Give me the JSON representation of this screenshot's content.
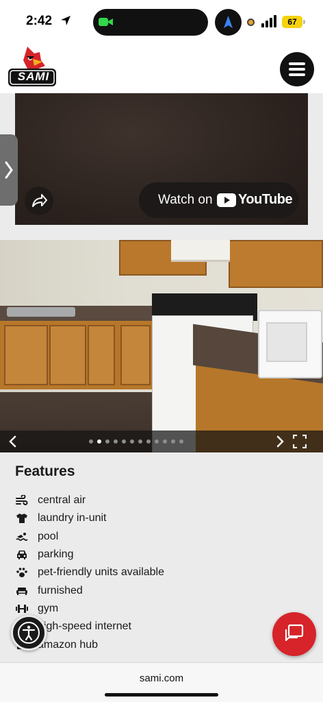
{
  "status_bar": {
    "time": "2:42",
    "battery": "67"
  },
  "header": {
    "logo_text": "SAMI",
    "menu_icon": "hamburger-icon"
  },
  "video": {
    "watch_on": "Watch on",
    "youtube": "YouTube",
    "share_icon": "share-icon"
  },
  "gallery": {
    "total_slides": 12,
    "active_slide": 2
  },
  "features": {
    "title": "Features",
    "items": [
      {
        "icon": "wind-icon",
        "label": "central air"
      },
      {
        "icon": "shirt-icon",
        "label": "laundry in-unit"
      },
      {
        "icon": "swimmer-icon",
        "label": "pool"
      },
      {
        "icon": "car-icon",
        "label": "parking"
      },
      {
        "icon": "paw-icon",
        "label": "pet-friendly units available"
      },
      {
        "icon": "couch-icon",
        "label": "furnished"
      },
      {
        "icon": "dumbbell-icon",
        "label": "gym"
      },
      {
        "icon": "wifi-icon",
        "label": "high-speed internet"
      },
      {
        "icon": "package-icon",
        "label": "amazon hub"
      }
    ]
  },
  "browser": {
    "url": "sami.com"
  },
  "colors": {
    "brand_red": "#d6242a",
    "dark": "#111111",
    "battery_yellow": "#f5d20f"
  }
}
